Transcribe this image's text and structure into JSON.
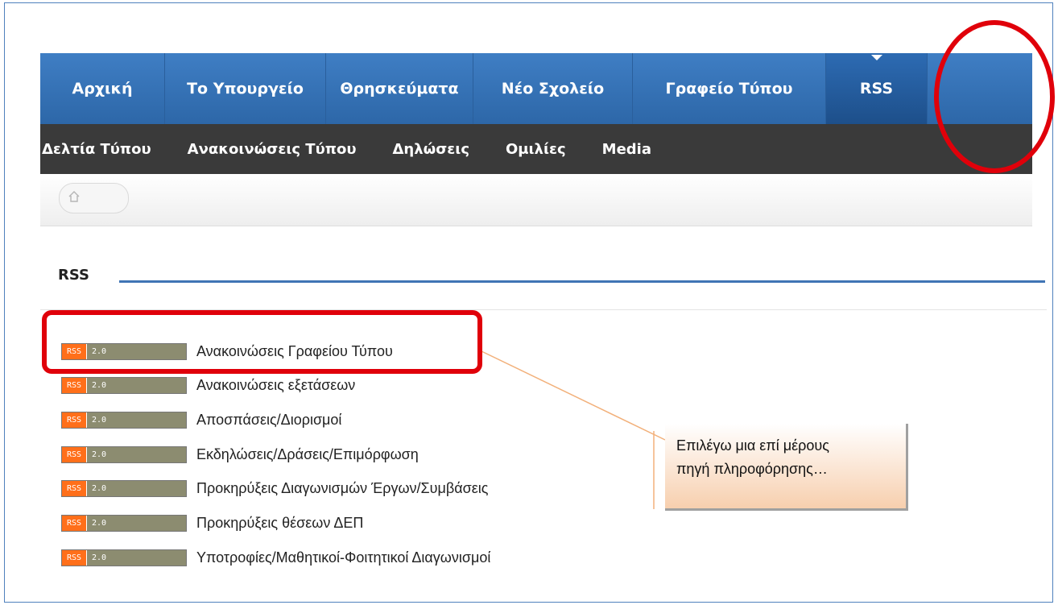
{
  "top_nav": {
    "items": [
      "Αρχική",
      "Το Υπουργείο",
      "Θρησκεύματα",
      "Νέο Σχολείο",
      "Γραφείο Τύπου",
      "RSS"
    ],
    "active": "RSS"
  },
  "sub_nav": {
    "items": [
      "Δελτία Τύπου",
      "Ανακοινώσεις Τύπου",
      "Δηλώσεις",
      "Ομιλίες",
      "Media"
    ]
  },
  "breadcrumb": {
    "icon": "home-icon"
  },
  "section": {
    "title": "RSS"
  },
  "feed_badge": {
    "left": "RSS",
    "right": "2.0"
  },
  "feeds": [
    "Ανακοινώσεις Γραφείου Τύπου",
    "Ανακοινώσεις εξετάσεων",
    "Αποσπάσεις/Διορισμοί",
    "Εκδηλώσεις/Δράσεις/Επιμόρφωση",
    "Προκηρύξεις Διαγωνισμών Έργων/Συμβάσεις",
    "Προκηρύξεις θέσεων ΔΕΠ",
    "Υποτροφίες/Μαθητικοί-Φοιτητικοί Διαγωνισμοί"
  ],
  "callout": {
    "line1": "Επιλέγω μια επί μέρους",
    "line2": "πηγή πληροφόρησης…"
  },
  "colors": {
    "nav_blue": "#2d67a8",
    "subnav_dark": "#3a3a3a",
    "annotation_red": "#e0000a",
    "rss_orange": "#ff6f1a"
  }
}
